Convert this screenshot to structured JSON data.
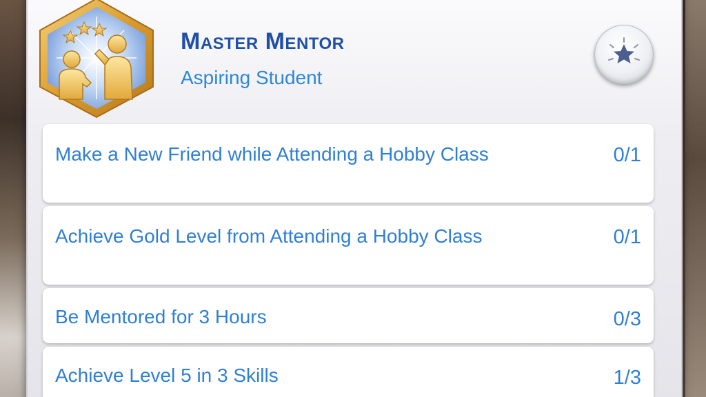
{
  "aspiration": {
    "title": "Master Mentor",
    "milestone": "Aspiring Student",
    "badge_icon": "mentor-figures-icon",
    "action_icon": "star-icon"
  },
  "goals": [
    {
      "text": "Make a New Friend while Attending a Hobby Class",
      "progress": "0/1"
    },
    {
      "text": "Achieve Gold Level from Attending a Hobby Class",
      "progress": "0/1"
    },
    {
      "text": "Be Mentored for 3 Hours",
      "progress": "0/3"
    },
    {
      "text": "Achieve Level 5 in 3 Skills",
      "progress": "1/3"
    }
  ],
  "colors": {
    "title": "#1f4fa6",
    "accent": "#2f7fd4",
    "badge_gold": "#e0a93a",
    "badge_blue": "#8fb4e8"
  }
}
